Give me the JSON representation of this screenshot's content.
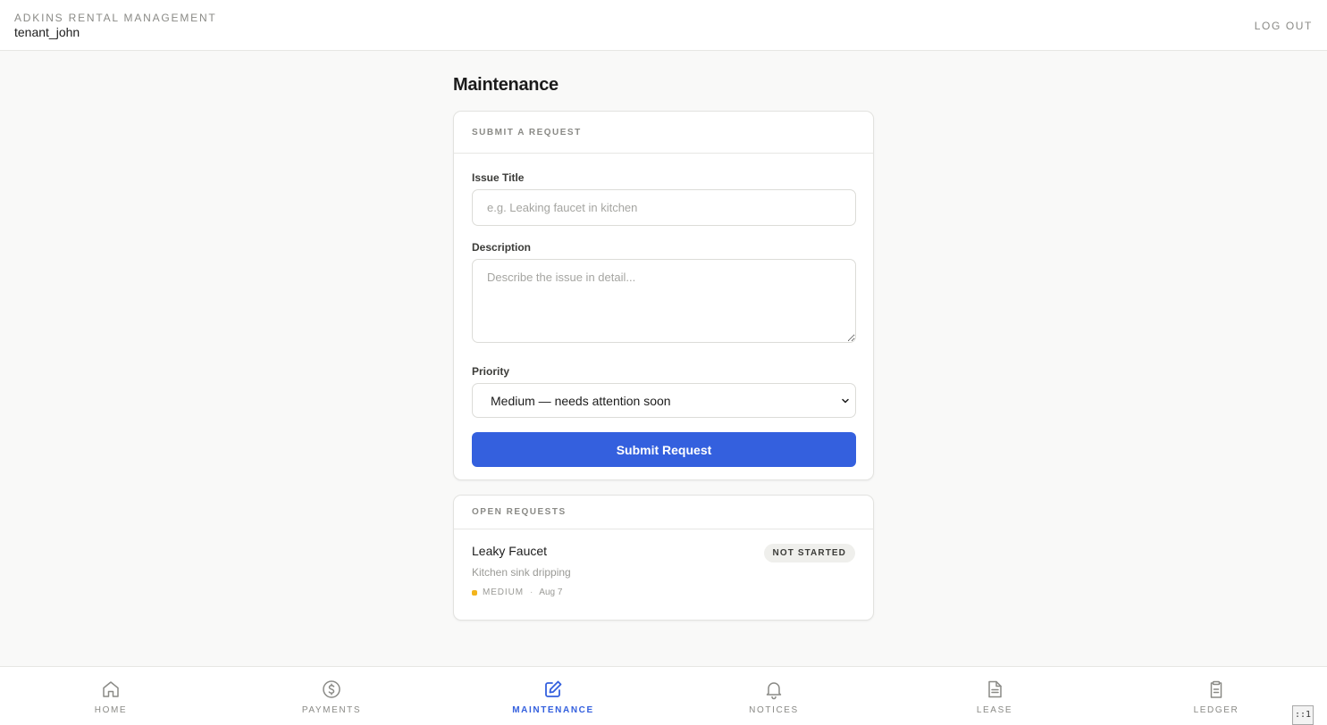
{
  "header": {
    "brand": "ADKINS RENTAL MANAGEMENT",
    "username": "tenant_john",
    "logout_label": "LOG OUT"
  },
  "page": {
    "title": "Maintenance"
  },
  "submit_card": {
    "heading": "SUBMIT A REQUEST",
    "issue_title_label": "Issue Title",
    "issue_title_placeholder": "e.g. Leaking faucet in kitchen",
    "issue_title_value": "",
    "description_label": "Description",
    "description_placeholder": "Describe the issue in detail...",
    "description_value": "",
    "priority_label": "Priority",
    "priority_selected": "Medium — needs attention soon",
    "submit_label": "Submit Request"
  },
  "open_requests": {
    "heading": "OPEN REQUESTS",
    "items": [
      {
        "title": "Leaky Faucet",
        "status": "NOT STARTED",
        "description": "Kitchen sink dripping",
        "priority": "MEDIUM",
        "separator": "·",
        "date": "Aug 7",
        "priority_color": "#f3b41c"
      }
    ]
  },
  "nav": {
    "items": [
      {
        "label": "HOME",
        "icon": "home-icon"
      },
      {
        "label": "PAYMENTS",
        "icon": "dollar-circle-icon"
      },
      {
        "label": "MAINTENANCE",
        "icon": "edit-icon",
        "active": true
      },
      {
        "label": "NOTICES",
        "icon": "bell-icon"
      },
      {
        "label": "LEASE",
        "icon": "document-icon"
      },
      {
        "label": "LEDGER",
        "icon": "clipboard-icon"
      }
    ]
  },
  "corner_tag": "::1",
  "colors": {
    "accent": "#3460de",
    "priority_medium": "#f3b41c",
    "page_background": "#f9f9f8"
  }
}
